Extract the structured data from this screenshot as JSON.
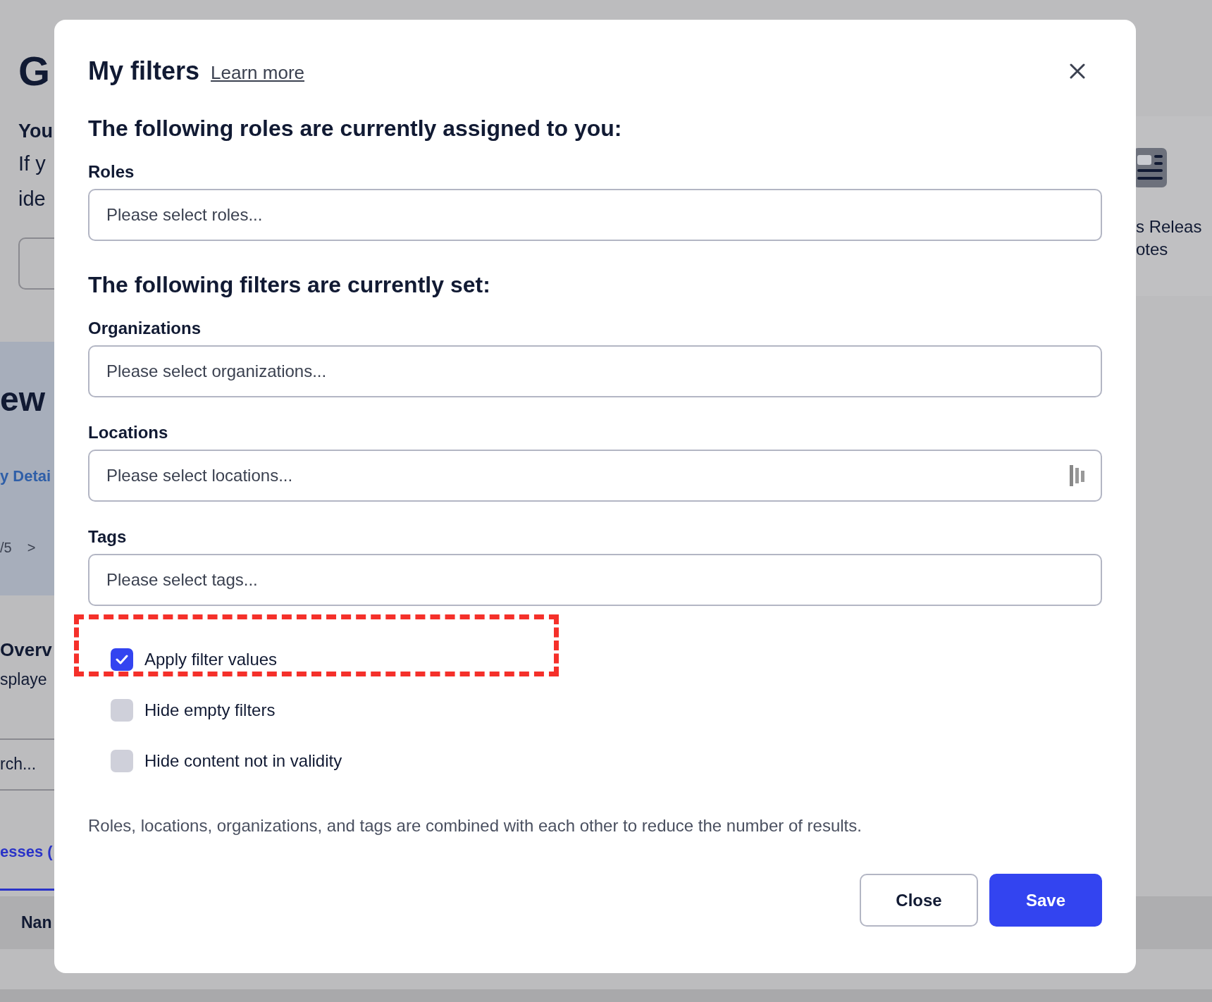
{
  "background": {
    "left": {
      "heading": "G",
      "subheading": "You",
      "intro_lines": [
        "If y",
        "ide"
      ],
      "banner_title": "ew",
      "banner_link": "y Detai",
      "pager_text": "/5",
      "pager_next": ">",
      "section_title": "Overv",
      "section_text": "splaye",
      "search_placeholder": "rch...",
      "tab": "esses (",
      "column": "Nan"
    },
    "right": {
      "card_lines": [
        "s Releas",
        "otes"
      ]
    }
  },
  "dialog": {
    "title": "My filters",
    "learn_more": "Learn more",
    "sections": [
      {
        "heading": "The following roles are currently assigned to you:",
        "fields": [
          {
            "label": "Roles",
            "placeholder": "Please select roles...",
            "loading": false
          }
        ]
      },
      {
        "heading": "The following filters are currently set:",
        "fields": [
          {
            "label": "Organizations",
            "placeholder": "Please select organizations...",
            "loading": false
          },
          {
            "label": "Locations",
            "placeholder": "Please select locations...",
            "loading": true
          },
          {
            "label": "Tags",
            "placeholder": "Please select tags...",
            "loading": false
          }
        ]
      }
    ],
    "options": [
      {
        "label": "Apply filter values",
        "checked": true,
        "highlighted": true
      },
      {
        "label": "Hide empty filters",
        "checked": false,
        "highlighted": false
      },
      {
        "label": "Hide content not in validity",
        "checked": false,
        "highlighted": false
      }
    ],
    "note": "Roles, locations, organizations, and tags are combined with each other to reduce the number of results.",
    "buttons": [
      {
        "label": "Close",
        "kind": "secondary"
      },
      {
        "label": "Save",
        "kind": "primary"
      }
    ]
  }
}
